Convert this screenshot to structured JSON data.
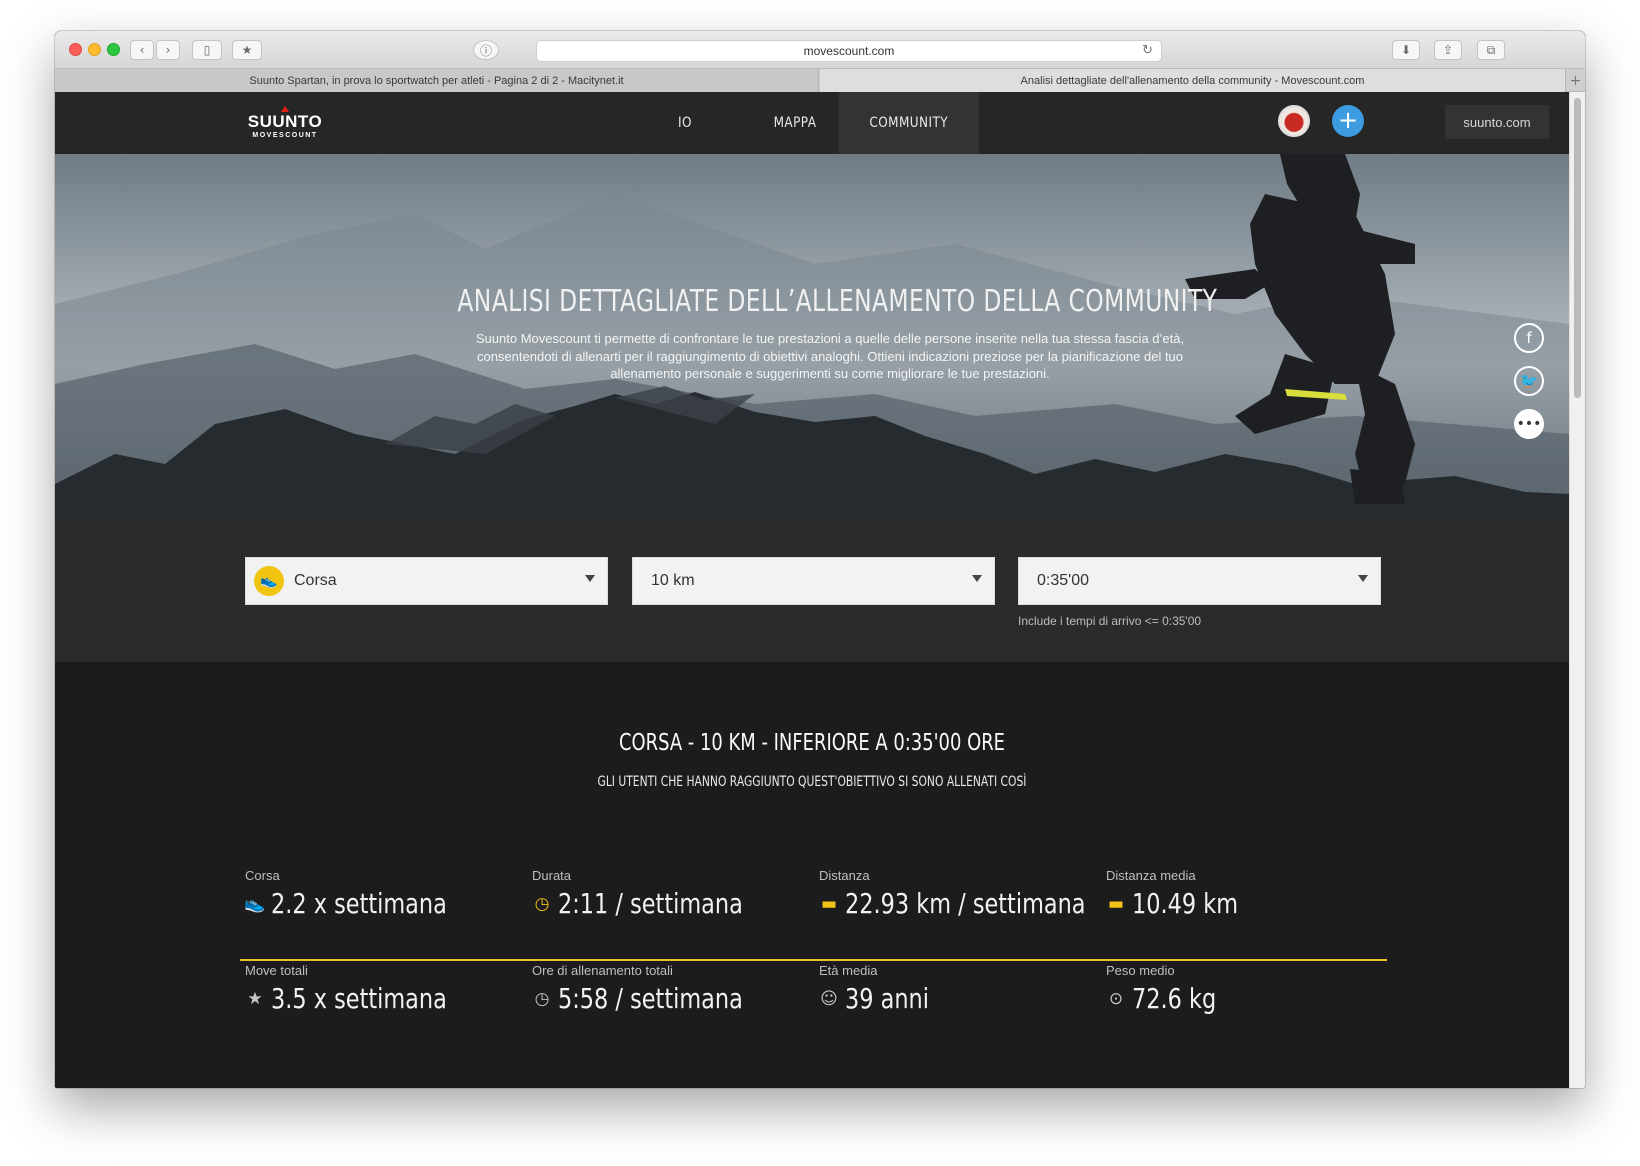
{
  "browser": {
    "url": "movescount.com",
    "tabs": [
      {
        "label": "Suunto Spartan, in prova lo sportwatch per atleti - Pagina 2 di 2 - Macitynet.it"
      },
      {
        "label": "Analisi dettagliate dell'allenamento della community - Movescount.com"
      }
    ]
  },
  "nav": {
    "logo_main": "SUUNTO",
    "logo_sub": "MOVESCOUNT",
    "items": [
      {
        "label": "IO"
      },
      {
        "label": "MAPPA"
      },
      {
        "label": "COMMUNITY"
      }
    ],
    "plus": "+",
    "suunto_link": "suunto.com"
  },
  "hero": {
    "title": "ANALISI DETTAGLIATE DELL’ALLENAMENTO DELLA COMMUNITY",
    "description": "Suunto Movescount ti permette di confrontare le tue prestazioni a quelle delle persone inserite nella tua stessa fascia d’età, consentendoti di allenarti per il raggiungimento di obiettivi analoghi. Ottieni indicazioni preziose per la pianificazione del tuo allenamento personale e suggerimenti su come migliorare le tue prestazioni."
  },
  "share": {
    "facebook": "f",
    "twitter": "🐦",
    "more": "•••"
  },
  "filters": {
    "sport": "Corsa",
    "distance": "10 km",
    "time": "0:35'00",
    "time_note": "Include i tempi di arrivo <= 0:35'00"
  },
  "results": {
    "title": "CORSA - 10 KM - INFERIORE A 0:35'00 ORE",
    "subtitle": "GLI UTENTI CHE HANNO RAGGIUNTO QUEST'OBIETTIVO SI SONO ALLENATI COSÌ",
    "stats_top": [
      {
        "label": "Corsa",
        "value": "2.2 x settimana",
        "icon": "running-shoe-icon"
      },
      {
        "label": "Durata",
        "value": "2:11 / settimana",
        "icon": "stopwatch-icon"
      },
      {
        "label": "Distanza",
        "value": "22.93 km / settimana",
        "icon": "ruler-icon"
      },
      {
        "label": "Distanza media",
        "value": "10.49 km",
        "icon": "ruler-icon"
      }
    ],
    "stats_bottom": [
      {
        "label": "Move totali",
        "value": "3.5 x settimana",
        "icon": "star-icon"
      },
      {
        "label": "Ore di allenamento totali",
        "value": "5:58 / settimana",
        "icon": "stopwatch-icon"
      },
      {
        "label": "Età media",
        "value": "39 anni",
        "icon": "age-icon"
      },
      {
        "label": "Peso medio",
        "value": "72.6 kg",
        "icon": "weight-icon"
      }
    ]
  },
  "colors": {
    "accent_yellow": "#f2c318",
    "plus_blue": "#3d9be0",
    "page_bg": "#1c1c1c"
  }
}
